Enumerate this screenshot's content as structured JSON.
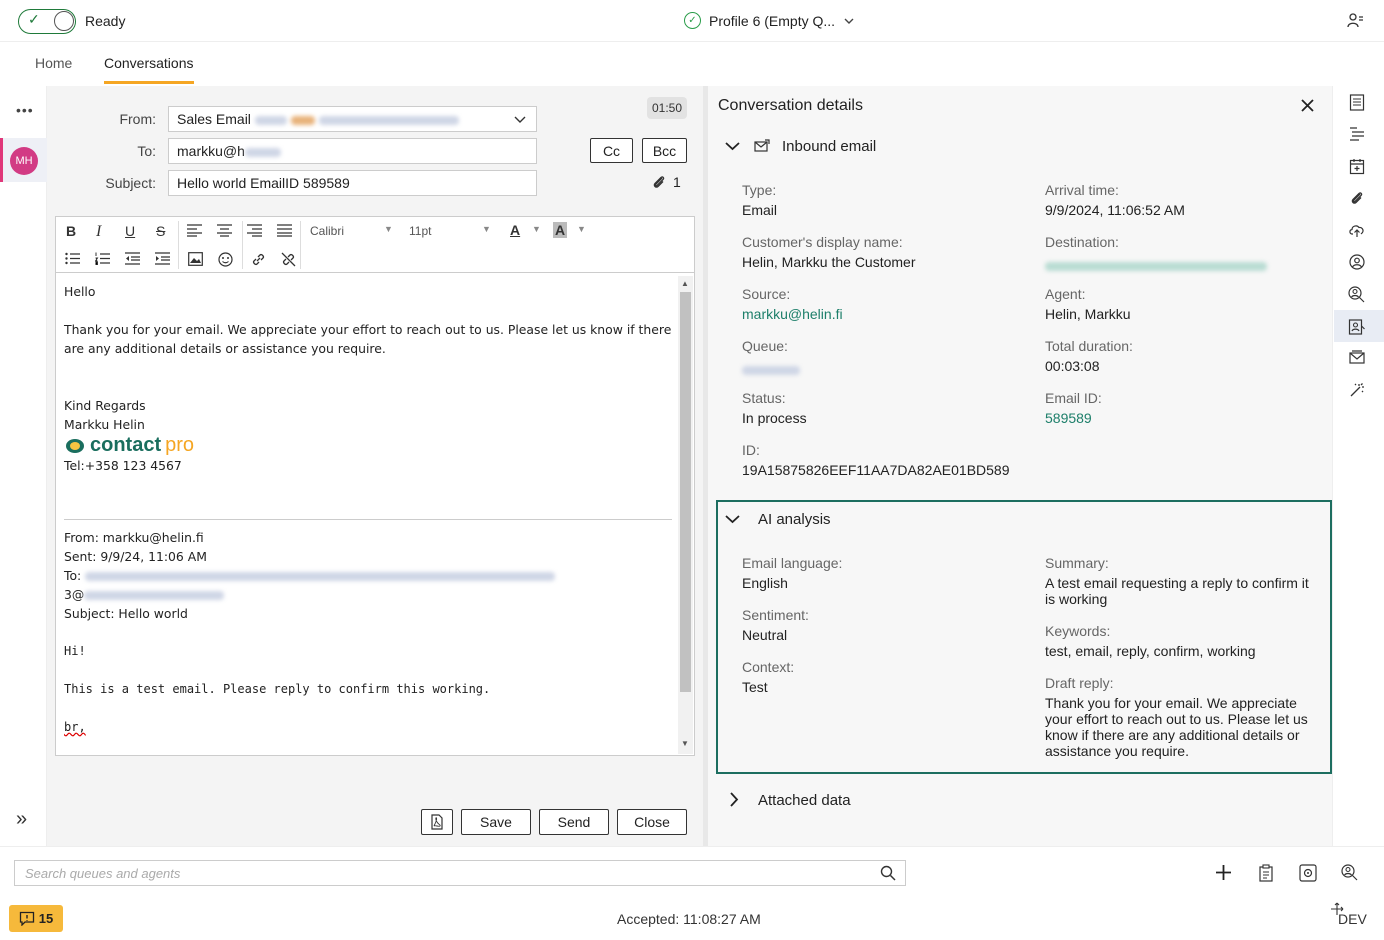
{
  "topbar": {
    "status": "Ready",
    "profile": "Profile 6 (Empty Q...",
    "colors": {
      "status_green": "#1f7a3a",
      "accent": "#f5a623",
      "teal": "#1d7f6a"
    }
  },
  "nav": {
    "home": "Home",
    "conversations": "Conversations"
  },
  "rail": {
    "more": "•••",
    "avatar": "MH",
    "expand": "»"
  },
  "composer": {
    "timer": "01:50",
    "from_label": "From:",
    "from_value": "Sales Email",
    "to_label": "To:",
    "to_value": "markku@h",
    "subject_label": "Subject:",
    "subject_value": "Hello world EmailID 589589",
    "cc": "Cc",
    "bcc": "Bcc",
    "attachments_count": "1",
    "font_name": "Calibri",
    "font_size": "11pt",
    "save": "Save",
    "send": "Send",
    "close": "Close"
  },
  "body": {
    "greeting": "Hello",
    "para": "Thank you for your email. We appreciate your effort to reach out to us. Please let us know if there are any additional details or assistance you require.",
    "regards": "Kind Regards",
    "name": "Markku Helin",
    "logo_a": "contact",
    "logo_b": "pro",
    "tel": "Tel:+358 123 4567",
    "q_from": "From: markku@helin.fi",
    "q_sent": "Sent: 9/9/24, 11:06 AM",
    "q_to": "To:",
    "q_to2": "3@",
    "q_subject": "Subject: Hello world",
    "q_hi": "Hi!",
    "q_body": "This is a test email. Please reply to confirm this working.",
    "q_br": "br,"
  },
  "details": {
    "title": "Conversation details",
    "inbound_title": "Inbound email",
    "type_label": "Type:",
    "type_value": "Email",
    "arrival_label": "Arrival time:",
    "arrival_value": "9/9/2024, 11:06:52 AM",
    "display_label": "Customer's display name:",
    "display_value": "Helin, Markku the Customer",
    "dest_label": "Destination:",
    "source_label": "Source:",
    "source_value": "markku@helin.fi",
    "agent_label": "Agent:",
    "agent_value": "Helin, Markku",
    "queue_label": "Queue:",
    "duration_label": "Total duration:",
    "duration_value": "00:03:08",
    "status_label": "Status:",
    "status_value": "In process",
    "emailid_label": "Email ID:",
    "emailid_value": "589589",
    "id_label": "ID:",
    "id_value": "19A15875826EEF11AA7DA82AE01BD589",
    "ai_title": "AI analysis",
    "lang_label": "Email language:",
    "lang_value": "English",
    "sentiment_label": "Sentiment:",
    "sentiment_value": "Neutral",
    "context_label": "Context:",
    "context_value": "Test",
    "summary_label": "Summary:",
    "summary_value": "A test email requesting a reply to confirm it is working",
    "keywords_label": "Keywords:",
    "keywords_value": "test, email, reply, confirm, working",
    "draft_label": "Draft reply:",
    "draft_value": "Thank you for your email. We appreciate your effort to reach out to us. Please let us know if there are any additional details or assistance you require.",
    "attached_title": "Attached data"
  },
  "bottom": {
    "search_placeholder": "Search queues and agents",
    "badge_count": "15",
    "accepted": "Accepted: 11:08:27 AM",
    "env": "DEV"
  }
}
